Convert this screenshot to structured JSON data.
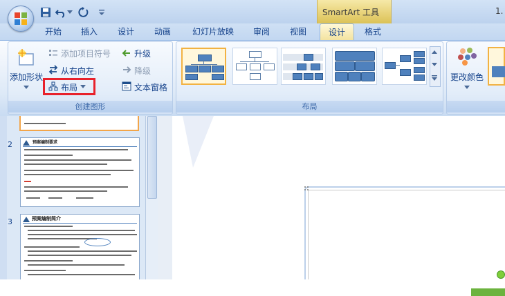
{
  "titlebar": {
    "contextual_title": "SmartArt 工具",
    "doc_title": "1."
  },
  "tabs": [
    {
      "label": "开始"
    },
    {
      "label": "插入"
    },
    {
      "label": "设计"
    },
    {
      "label": "动画"
    },
    {
      "label": "幻灯片放映"
    },
    {
      "label": "审阅"
    },
    {
      "label": "视图"
    },
    {
      "label": "设计"
    },
    {
      "label": "格式"
    }
  ],
  "ribbon": {
    "create_group": {
      "label": "创建图形",
      "add_shape": "添加形状",
      "add_bullet": "添加项目符号",
      "right_to_left": "从右向左",
      "layout": "布局",
      "promote": "升级",
      "demote": "降级",
      "text_pane": "文本窗格"
    },
    "layout_group": {
      "label": "布局"
    },
    "styles_group": {
      "change_colors": "更改颜色"
    }
  },
  "slides": [
    {
      "number": "2",
      "title": "预案编制要求"
    },
    {
      "number": "3",
      "title": "预案编制简介"
    }
  ],
  "colors": {
    "highlight": "#e8212b",
    "accent": "#4f81bd",
    "selection": "#f2b242"
  }
}
